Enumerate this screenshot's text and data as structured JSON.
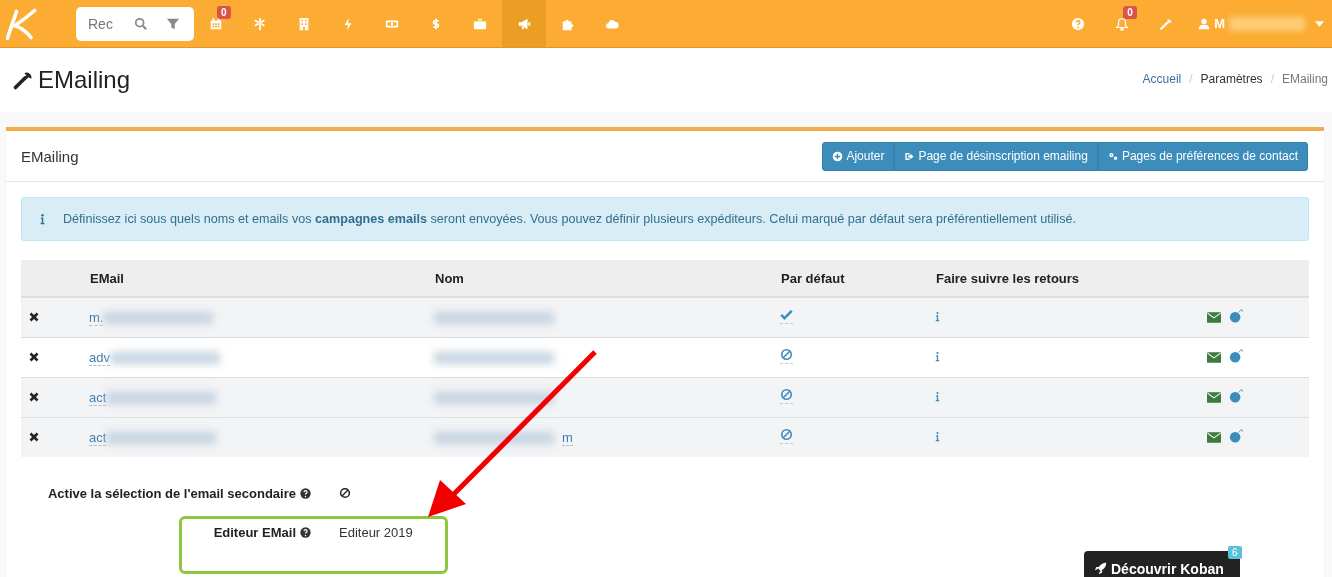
{
  "topbar": {
    "search": {
      "placeholder": "Rec"
    },
    "nav": [
      {
        "kind": "calendar",
        "badge": "0",
        "selected": false
      },
      {
        "kind": "asterisk",
        "selected": false
      },
      {
        "kind": "building",
        "selected": false
      },
      {
        "kind": "bolt",
        "selected": false
      },
      {
        "kind": "money",
        "selected": false
      },
      {
        "kind": "dollar",
        "selected": false
      },
      {
        "kind": "briefcase",
        "selected": false
      },
      {
        "kind": "megaphone",
        "selected": true
      },
      {
        "kind": "puzzle",
        "selected": false
      },
      {
        "kind": "cloud",
        "selected": false
      }
    ],
    "notifications_badge": "0",
    "user": "M"
  },
  "page": {
    "title": "EMailing",
    "breadcrumb_separator": "/",
    "breadcrumb": [
      {
        "label": "Accueil",
        "kind": "link"
      },
      {
        "label": "Paramètres",
        "kind": "text"
      },
      {
        "label": "EMailing",
        "kind": "current"
      }
    ]
  },
  "panel": {
    "title": "EMailing",
    "buttons": [
      {
        "label": "Ajouter",
        "kind": "add"
      },
      {
        "label": "Page de désinscription emailing",
        "kind": "signout"
      },
      {
        "label": "Pages de préférences de contact",
        "kind": "gears"
      }
    ],
    "info": "Définissez ici sous quels noms et emails vos **campagnes emails** seront envoyées. Vous pouvez définir plusieurs expéditeurs. Celui marqué par défaut sera préférentiellement utilisé.",
    "table": {
      "columns": [
        "EMail",
        "Nom",
        "Par défaut",
        "Faire suivre les retours"
      ],
      "rows": [
        {
          "email": "m.",
          "default": true
        },
        {
          "email": "adv",
          "default": false
        },
        {
          "email": "act",
          "default": false
        },
        {
          "email": "act",
          "name": "m",
          "default": false
        }
      ]
    },
    "settings": [
      {
        "label": "Active la sélection de l'email secondaire",
        "kind": "toggle",
        "on": false
      },
      {
        "label": "Editeur EMail",
        "kind": "text",
        "value": "Editeur 2019"
      }
    ]
  },
  "discover": {
    "label": "Découvrir Koban",
    "badge": "6"
  }
}
